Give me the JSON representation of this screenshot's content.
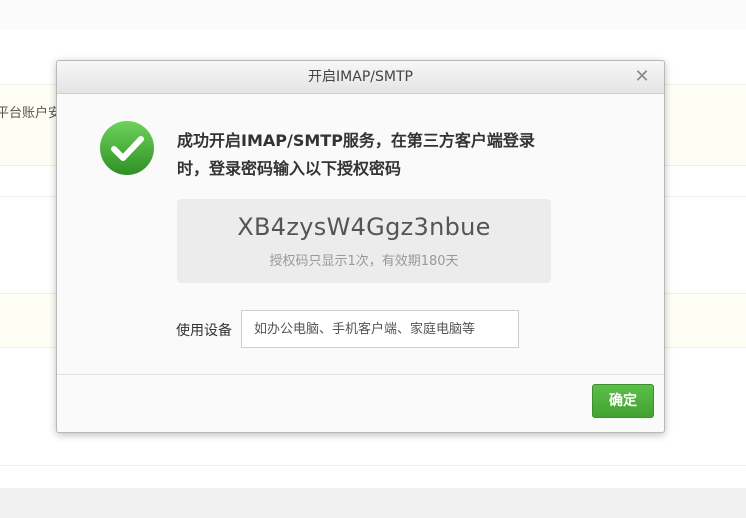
{
  "background": {
    "row_text": "平台账户安"
  },
  "dialog": {
    "title": "开启IMAP/SMTP",
    "close_icon": "close-icon",
    "success_icon": "check-circle-icon",
    "message": "成功开启IMAP/SMTP服务，在第三方客户端登录时，登录密码输入以下授权密码",
    "auth_code": "XB4zysW4Ggz3nbue",
    "auth_note": "授权码只显示1次，有效期180天",
    "device_label": "使用设备",
    "device_placeholder": "如办公电脑、手机客户端、家庭电脑等",
    "device_value": "",
    "confirm_label": "确定",
    "colors": {
      "success_green": "#4caf3e",
      "button_green": "#4cae3a"
    }
  }
}
